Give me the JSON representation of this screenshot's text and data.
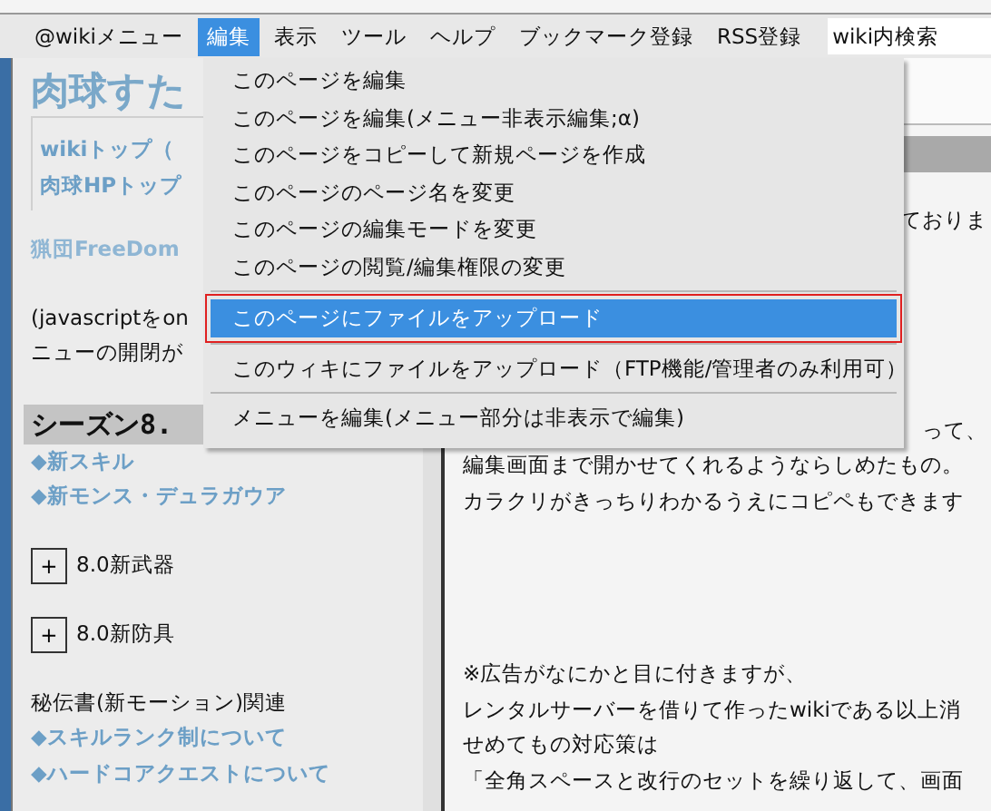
{
  "menubar": {
    "items": [
      {
        "label": "@wikiメニュー",
        "selected": false
      },
      {
        "label": "編集",
        "selected": true
      },
      {
        "label": "表示",
        "selected": false
      },
      {
        "label": "ツール",
        "selected": false
      },
      {
        "label": "ヘルプ",
        "selected": false
      },
      {
        "label": "ブックマーク登録",
        "selected": false
      },
      {
        "label": "RSS登録",
        "selected": false
      }
    ],
    "search": {
      "value": "wiki内検索"
    }
  },
  "edit_menu": [
    {
      "kind": "item",
      "label": "このページを編集",
      "selected": false
    },
    {
      "kind": "item",
      "label": "このページを編集(メニュー非表示編集;α)",
      "selected": false
    },
    {
      "kind": "item",
      "label": "このページをコピーして新規ページを作成",
      "selected": false
    },
    {
      "kind": "item",
      "label": "このページのページ名を変更",
      "selected": false
    },
    {
      "kind": "item",
      "label": "このページの編集モードを変更",
      "selected": false
    },
    {
      "kind": "item",
      "label": "このページの閲覧/編集権限の変更",
      "selected": false
    },
    {
      "kind": "separator"
    },
    {
      "kind": "item",
      "label": "このページにファイルをアップロード",
      "selected": true
    },
    {
      "kind": "separator"
    },
    {
      "kind": "item",
      "label": "このウィキにファイルをアップロード（FTP機能/管理者のみ利用可）",
      "selected": false
    },
    {
      "kind": "separator"
    },
    {
      "kind": "item",
      "label": "メニューを編集(メニュー部分は非表示で編集)",
      "selected": false
    }
  ],
  "sidebar": {
    "title": "肉球すた",
    "box": [
      {
        "kind": "link",
        "text": "wikiトップ（"
      },
      {
        "kind": "link",
        "text": "肉球HPトップ"
      }
    ],
    "sections": [
      [
        {
          "kind": "faded-link",
          "text": "猟団FreeDom"
        }
      ],
      [
        {
          "kind": "text",
          "text": "(javascriptをon"
        },
        {
          "kind": "text",
          "text": "ニューの開閉が"
        }
      ],
      [
        {
          "kind": "heading",
          "text": "シーズン8."
        },
        {
          "kind": "link",
          "text": "◆新スキル"
        },
        {
          "kind": "link",
          "text": "◆新モンス・デュラガウア"
        }
      ],
      [
        {
          "kind": "toggle",
          "symbol": "+",
          "text": "8.0新武器"
        }
      ],
      [
        {
          "kind": "toggle",
          "symbol": "+",
          "text": "8.0新防具"
        }
      ],
      [
        {
          "kind": "text",
          "text": "秘伝書(新モーション)関連"
        },
        {
          "kind": "link",
          "text": "◆スキルランク制について"
        },
        {
          "kind": "link",
          "text": "◆ハードコアクエストについて"
        }
      ]
    ]
  },
  "content": {
    "sections": [
      [
        {
          "kind": "tail",
          "text": "ておりま"
        }
      ],
      [
        {
          "kind": "tail",
          "text": "って、"
        },
        {
          "kind": "line",
          "text": "編集画面まで開かせてくれるようならしめたもの。"
        },
        {
          "kind": "line",
          "text": "カラクリがきっちりわかるうえにコピペもできます"
        }
      ],
      [
        {
          "kind": "line",
          "text": "※広告がなにかと目に付きますが、"
        },
        {
          "kind": "line",
          "text": "レンタルサーバーを借りて作ったwikiである以上消"
        },
        {
          "kind": "line",
          "text": "せめてもの対応策は"
        },
        {
          "kind": "line",
          "text": "「全角スペースと改行のセットを繰り返して、画面"
        }
      ]
    ]
  }
}
